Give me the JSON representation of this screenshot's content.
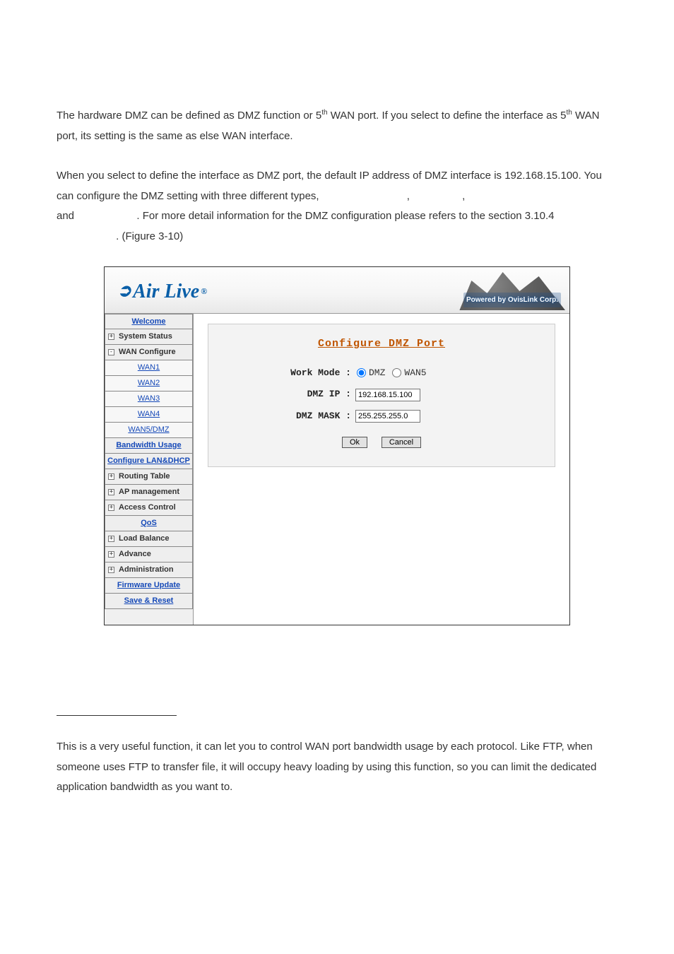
{
  "doc": {
    "p1_a": "The hardware DMZ can be defined as DMZ function or 5",
    "p1_b": " WAN port. If you select to define the interface as 5",
    "p1_c": " WAN port, its setting is the same as else WAN interface.",
    "sup_th": "th",
    "p2_a": "When you select to define the interface as DMZ port, the default IP address of DMZ interface is 192.168.15.100. You can configure the DMZ setting with three different types, ",
    "p2_gap1": ", ",
    "p2_gap2": ", ",
    "p2_b": "and ",
    "p2_c": ". For more detail information for the DMZ configuration please refers to the section 3.10.4 ",
    "p2_d": ". (Figure 3-10)",
    "p3": "This is a very useful function, it can let you to control WAN port bandwidth usage by each protocol. Like FTP, when someone uses FTP to transfer file, it will occupy heavy loading by using this function, so you can limit the dedicated application bandwidth as you want to."
  },
  "ui": {
    "brand": "Air Live",
    "powered": "Powered by OvisLink Corp.",
    "menu": {
      "welcome": "Welcome",
      "system_status": "System Status",
      "wan_configure": "WAN Configure",
      "wan1": "WAN1",
      "wan2": "WAN2",
      "wan3": "WAN3",
      "wan4": "WAN4",
      "wan5dmz": "WAN5/DMZ",
      "bandwidth_usage": "Bandwidth Usage",
      "configure_lan_dhcp": "Configure LAN&DHCP",
      "routing_table": "Routing Table",
      "ap_management": "AP management",
      "access_control": "Access Control",
      "qos": "QoS",
      "load_balance": "Load Balance",
      "advance": "Advance",
      "administration": "Administration",
      "firmware_update": "Firmware Update",
      "save_reset": "Save & Reset"
    },
    "panel": {
      "title": "Configure DMZ Port",
      "work_mode_label": "Work Mode :",
      "opt_dmz": "DMZ",
      "opt_wan5": "WAN5",
      "dmz_ip_label": "DMZ IP :",
      "dmz_ip_value": "192.168.15.100",
      "dmz_mask_label": "DMZ MASK :",
      "dmz_mask_value": "255.255.255.0",
      "ok": "Ok",
      "cancel": "Cancel"
    }
  }
}
